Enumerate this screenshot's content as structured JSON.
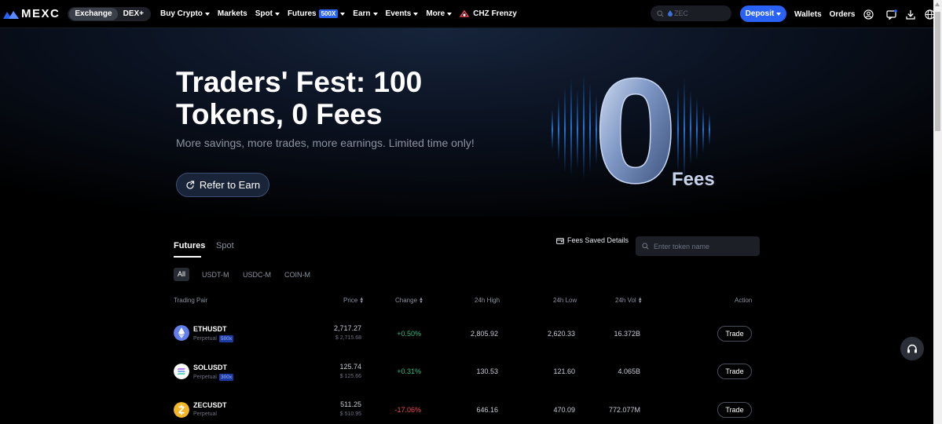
{
  "nav": {
    "logo_text": "MEXC",
    "segments": [
      "Exchange",
      "DEX+"
    ],
    "links": [
      {
        "label": "Buy Crypto",
        "caret": true
      },
      {
        "label": "Markets",
        "caret": false
      },
      {
        "label": "Spot",
        "caret": true
      },
      {
        "label": "Futures",
        "caret": true,
        "badge": "500X"
      },
      {
        "label": "Earn",
        "caret": true
      },
      {
        "label": "Events",
        "caret": true
      },
      {
        "label": "More",
        "caret": true
      }
    ],
    "promo": "CHZ Frenzy",
    "search_placeholder": "ZEC",
    "deposit": "Deposit",
    "wallets": "Wallets",
    "orders": "Orders",
    "icons": [
      "user-icon",
      "message-icon",
      "download-icon",
      "globe-icon"
    ]
  },
  "hero": {
    "title": "Traders' Fest: 100 Tokens, 0 Fees",
    "subtitle": "More savings, more trades, more earnings. Limited time only!",
    "cta": "Refer to Earn",
    "art_zero": "0",
    "art_fees": "Fees"
  },
  "tabs": {
    "main": [
      "Futures",
      "Spot"
    ],
    "fees_saved": "Fees Saved Details",
    "token_search_placeholder": "Enter token name",
    "sub": [
      "All",
      "USDT-M",
      "USDC-M",
      "COIN-M"
    ]
  },
  "table": {
    "headers": {
      "pair": "Trading Pair",
      "price": "Price",
      "change": "Change",
      "high": "24h High",
      "low": "24h Low",
      "vol": "24h Vol",
      "action": "Action"
    },
    "rows": [
      {
        "symbol": "ETHUSDT",
        "type": "Perpetual",
        "leverage": "500x",
        "price": "2,717.27",
        "price_usd": "$ 2,715.68",
        "change": "+0.50%",
        "high": "2,805.92",
        "low": "2,620.33",
        "vol": "16.372B",
        "action": "Trade",
        "coin_color": "#627eea"
      },
      {
        "symbol": "SOLUSDT",
        "type": "Perpetual",
        "leverage": "300x",
        "price": "125.74",
        "price_usd": "$ 125.66",
        "change": "+0.31%",
        "high": "130.53",
        "low": "121.60",
        "vol": "4.065B",
        "action": "Trade",
        "coin_color": "#ffffff"
      },
      {
        "symbol": "ZECUSDT",
        "type": "Perpetual",
        "leverage": "",
        "price": "511.25",
        "price_usd": "$ 510.95",
        "change": "-17.06%",
        "high": "646.16",
        "low": "470.09",
        "vol": "772.077M",
        "action": "Trade",
        "coin_color": "#f4b728"
      }
    ]
  }
}
